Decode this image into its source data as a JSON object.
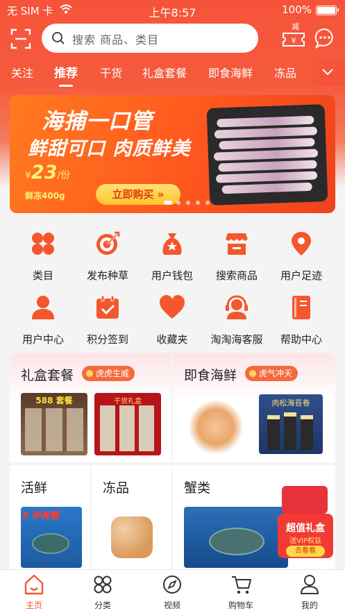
{
  "status_bar": {
    "carrier": "无 SIM 卡",
    "time": "上午8:57",
    "battery_percent": "100%"
  },
  "header": {
    "search_placeholder": "搜索 商品、类目",
    "coupon_badge": "减",
    "coupon_symbol": "¥"
  },
  "category_tabs": [
    {
      "label": "关注",
      "active": false
    },
    {
      "label": "推荐",
      "active": true
    },
    {
      "label": "干货",
      "active": false
    },
    {
      "label": "礼盒套餐",
      "active": false
    },
    {
      "label": "即食海鲜",
      "active": false
    },
    {
      "label": "冻品",
      "active": false
    }
  ],
  "banner": {
    "headline": "海捕一口管",
    "subhead": "鲜甜可口 肉质鲜美",
    "currency": "¥",
    "price": "23",
    "price_unit": "/份",
    "weight": "鲜冻400g",
    "buy_button": "立即购买 »",
    "slides": 5,
    "active_slide": 0
  },
  "quick_actions": [
    {
      "label": "类目",
      "icon": "category-icon"
    },
    {
      "label": "发布种草",
      "icon": "target-icon"
    },
    {
      "label": "用户钱包",
      "icon": "money-bag-icon"
    },
    {
      "label": "搜索商品",
      "icon": "store-icon"
    },
    {
      "label": "用户足迹",
      "icon": "location-pin-icon"
    },
    {
      "label": "用户中心",
      "icon": "user-icon"
    },
    {
      "label": "积分签到",
      "icon": "calendar-check-icon"
    },
    {
      "label": "收藏夹",
      "icon": "heart-icon"
    },
    {
      "label": "淘淘海客服",
      "icon": "customer-service-icon"
    },
    {
      "label": "帮助中心",
      "icon": "help-book-icon"
    }
  ],
  "sections": {
    "gift_box": {
      "title": "礼盒套餐",
      "tag": "虎虎生威"
    },
    "ready_seafood": {
      "title": "即食海鲜",
      "tag": "虎气冲天"
    },
    "live": {
      "title": "活鲜"
    },
    "frozen": {
      "title": "冻品"
    },
    "crab": {
      "title": "蟹类"
    }
  },
  "product_thumbs": {
    "gift_1_text": "588 套餐",
    "gift_2_text": "干货礼盒",
    "seafood_2_text": "肉松海苔卷",
    "live_1_text": "9 种青蟹"
  },
  "promo_float": {
    "title": "超值礼盒",
    "subtitle": "送VIP权益",
    "button": "去看看"
  },
  "tab_bar": [
    {
      "label": "主页",
      "icon": "home-icon",
      "active": true
    },
    {
      "label": "分类",
      "icon": "grid-icon",
      "active": false
    },
    {
      "label": "视频",
      "icon": "compass-icon",
      "active": false
    },
    {
      "label": "购物车",
      "icon": "cart-icon",
      "active": false
    },
    {
      "label": "我的",
      "icon": "profile-icon",
      "active": false
    }
  ],
  "colors": {
    "brand": "#f6543a",
    "accent_orange": "#f4572d",
    "tag": "#f46a3c"
  }
}
